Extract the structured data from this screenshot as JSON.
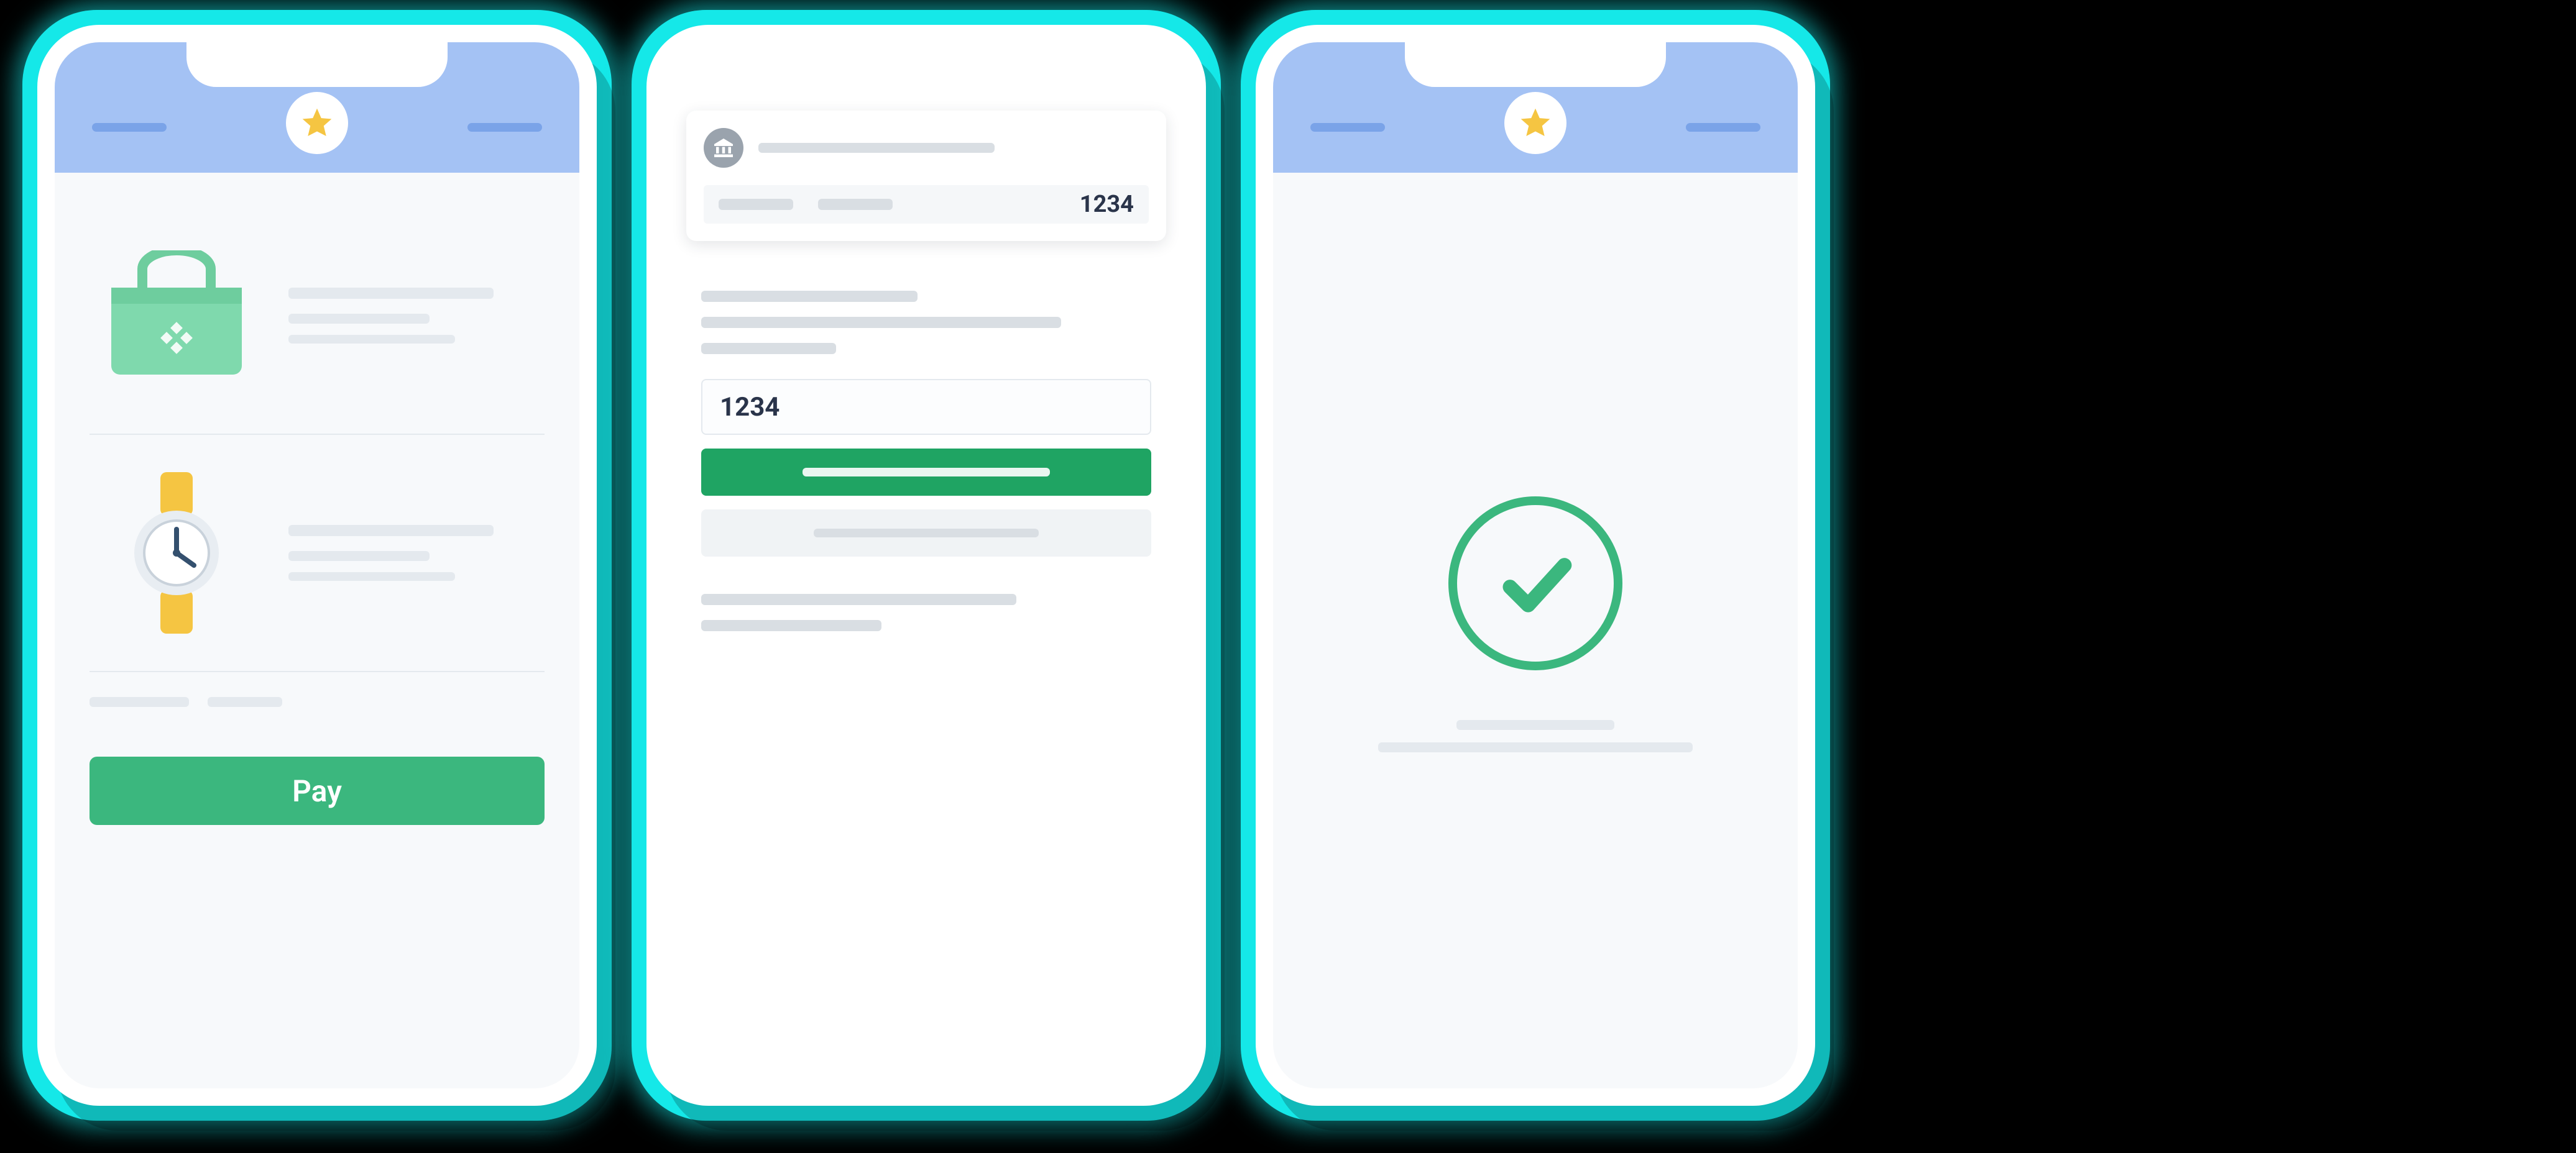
{
  "colors": {
    "accent_teal": "#15e8e8",
    "header_blue": "#a4c2f4",
    "primary_green": "#3bb77e",
    "confirm_green": "#1fa463",
    "star_yellow": "#f5c542"
  },
  "checkout": {
    "icons": {
      "product1": "bag-icon",
      "product2": "watch-icon"
    },
    "pay_button_label": "Pay"
  },
  "auth": {
    "bank_icon": "bank-icon",
    "card_last4": "1234",
    "otp_value": "1234"
  },
  "success": {
    "icon": "checkmark-icon"
  }
}
